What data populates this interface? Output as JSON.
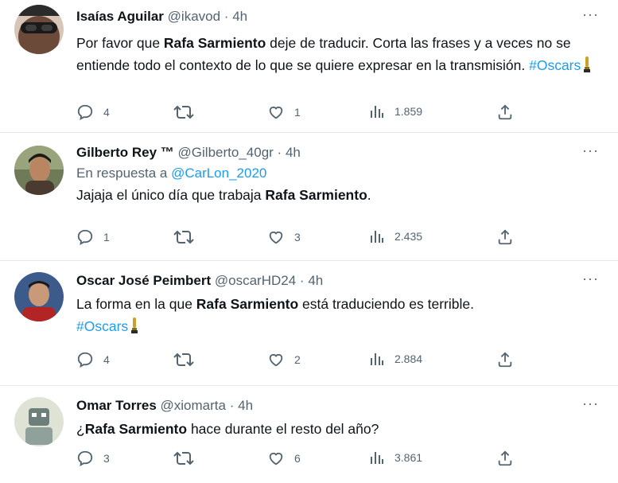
{
  "tweets": [
    {
      "name": "Isaías Aguilar",
      "handle": "@ikavod",
      "dot": "·",
      "time": "4h",
      "more": "···",
      "text_parts": [
        "Por favor que ",
        "Rafa Sarmiento",
        " deje de traducir. Corta las frases y a veces no se entiende todo el contexto de lo que se quiere expresar en la transmisión.  "
      ],
      "hashtag": "#Oscars",
      "replies": "4",
      "retweets": "",
      "likes": "1",
      "views": "1.859"
    },
    {
      "name": "Gilberto Rey ™",
      "handle": "@Gilberto_40gr",
      "dot": "·",
      "time": "4h",
      "more": "···",
      "reply_prefix": "En respuesta a ",
      "reply_mention": "@CarLon_2020",
      "text_parts": [
        "Jajaja el único día que trabaja ",
        "Rafa Sarmiento",
        "."
      ],
      "replies": "1",
      "retweets": "",
      "likes": "3",
      "views": "2.435"
    },
    {
      "name": "Oscar José Peimbert",
      "handle": "@oscarHD24",
      "dot": "·",
      "time": "4h",
      "more": "···",
      "text_parts": [
        "La forma en la que ",
        "Rafa Sarmiento",
        " está traduciendo es terrible."
      ],
      "hashtag": "#Oscars",
      "replies": "4",
      "retweets": "",
      "likes": "2",
      "views": "2.884"
    },
    {
      "name": "Omar Torres",
      "handle": "@xiomarta",
      "dot": "·",
      "time": "4h",
      "more": "···",
      "text_parts": [
        "¿",
        "Rafa Sarmiento",
        " hace durante el resto del año?"
      ],
      "replies": "3",
      "retweets": "",
      "likes": "6",
      "views": "3.861"
    }
  ],
  "colors": {
    "text": "#0f1419",
    "secondary": "#536471",
    "link": "#1d9bf0",
    "divider": "#e6e9ec"
  },
  "icons": [
    "reply-icon",
    "retweet-icon",
    "like-icon",
    "views-icon",
    "share-icon",
    "more-icon",
    "trophy-icon"
  ]
}
